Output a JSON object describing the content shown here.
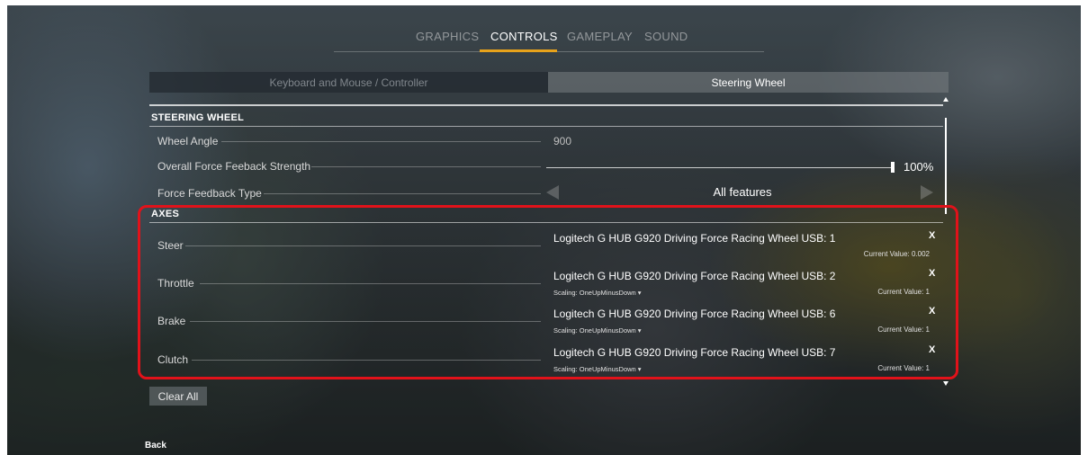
{
  "top_tabs": {
    "graphics": "GRAPHICS",
    "controls": "CONTROLS",
    "gameplay": "GAMEPLAY",
    "sound": "SOUND",
    "active": "CONTROLS",
    "accent_color": "#e7a21b"
  },
  "sub_tabs": {
    "keyboard": "Keyboard and Mouse / Controller",
    "wheel": "Steering Wheel",
    "active": "Steering Wheel"
  },
  "steering": {
    "header": "STEERING WHEEL",
    "wheel_angle_label": "Wheel Angle",
    "wheel_angle_value": "900",
    "force_strength_label": "Overall Force Feeback Strength",
    "force_strength_value": "100%",
    "force_type_label": "Force Feedback Type",
    "force_type_value": "All features"
  },
  "axes": {
    "header": "AXES",
    "rows": [
      {
        "label": "Steer",
        "device": "Logitech G HUB G920 Driving Force Racing Wheel USB: 1",
        "remove": "X",
        "scaling": "",
        "current": "Current Value: 0.002"
      },
      {
        "label": "Throttle",
        "device": "Logitech G HUB G920 Driving Force Racing Wheel USB: 2",
        "remove": "X",
        "scaling": "Scaling: OneUpMinusDown ▾",
        "current": "Current Value: 1"
      },
      {
        "label": "Brake",
        "device": "Logitech G HUB G920 Driving Force Racing Wheel USB: 6",
        "remove": "X",
        "scaling": "Scaling: OneUpMinusDown ▾",
        "current": "Current Value: 1"
      },
      {
        "label": "Clutch",
        "device": "Logitech G HUB G920 Driving Force Racing Wheel USB: 7",
        "remove": "X",
        "scaling": "Scaling: OneUpMinusDown ▾",
        "current": "Current Value: 1"
      }
    ]
  },
  "buttons": {
    "clear_all": "Clear All",
    "back": "Back"
  },
  "highlight_color": "#e1121a"
}
